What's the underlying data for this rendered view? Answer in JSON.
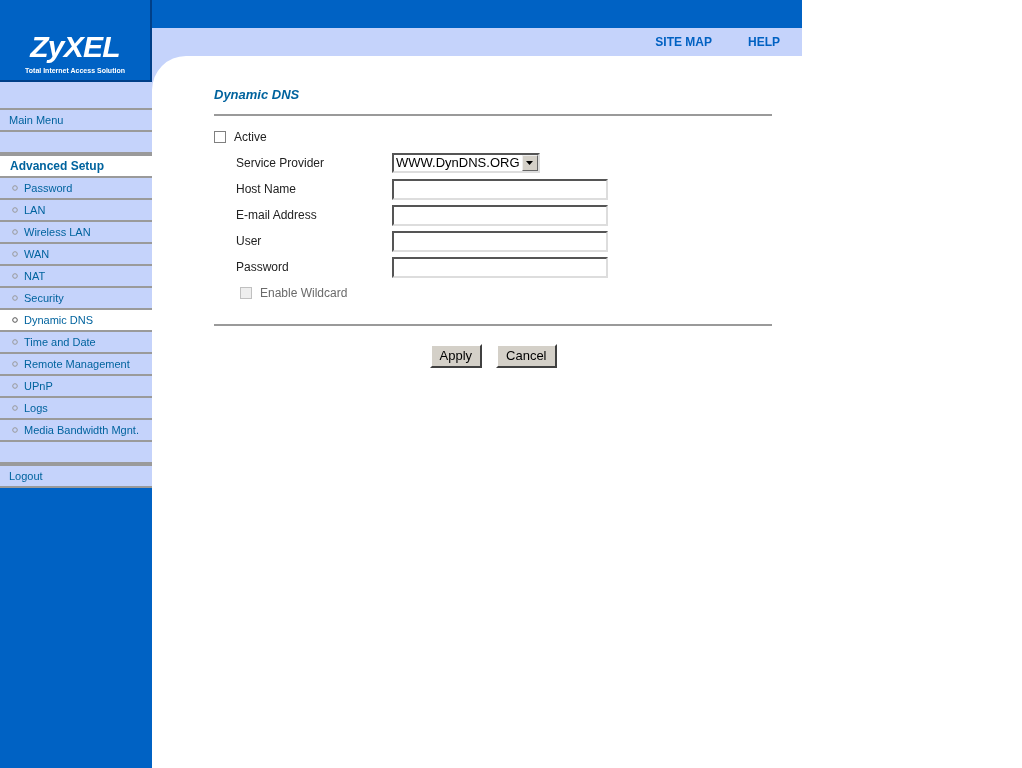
{
  "logo": {
    "name": "ZyXEL",
    "tagline": "Total Internet Access Solution"
  },
  "top_links": [
    "SITE MAP",
    "HELP"
  ],
  "sidebar": {
    "groups": [
      [
        {
          "label": "Main Menu",
          "kind": "top",
          "selected": false
        }
      ],
      [
        {
          "label": "Advanced Setup",
          "kind": "header",
          "selected": true
        },
        {
          "label": "Password",
          "kind": "sub",
          "selected": false
        },
        {
          "label": "LAN",
          "kind": "sub",
          "selected": false
        },
        {
          "label": "Wireless LAN",
          "kind": "sub",
          "selected": false
        },
        {
          "label": "WAN",
          "kind": "sub",
          "selected": false
        },
        {
          "label": "NAT",
          "kind": "sub",
          "selected": false
        },
        {
          "label": "Security",
          "kind": "sub",
          "selected": false
        },
        {
          "label": "Dynamic DNS",
          "kind": "sub",
          "selected": true
        },
        {
          "label": "Time and Date",
          "kind": "sub",
          "selected": false
        },
        {
          "label": "Remote Management",
          "kind": "sub",
          "selected": false
        },
        {
          "label": "UPnP",
          "kind": "sub",
          "selected": false
        },
        {
          "label": "Logs",
          "kind": "sub",
          "selected": false
        },
        {
          "label": "Media Bandwidth Mgnt.",
          "kind": "sub",
          "selected": false
        }
      ],
      [
        {
          "label": "Logout",
          "kind": "top",
          "selected": false
        }
      ]
    ]
  },
  "page": {
    "title": "Dynamic DNS",
    "fields": [
      {
        "kind": "checkbox",
        "label": "Active",
        "checked": false,
        "disabled": false
      },
      {
        "kind": "select",
        "label": "Service Provider",
        "value": "WWW.DynDNS.ORG"
      },
      {
        "kind": "text",
        "label": "Host Name"
      },
      {
        "kind": "text",
        "label": "E-mail Address"
      },
      {
        "kind": "text",
        "label": "User"
      },
      {
        "kind": "text",
        "label": "Password"
      },
      {
        "kind": "sub-checkbox",
        "label": "Enable Wildcard",
        "checked": false,
        "disabled": true
      }
    ],
    "buttons": [
      "Apply",
      "Cancel"
    ]
  }
}
